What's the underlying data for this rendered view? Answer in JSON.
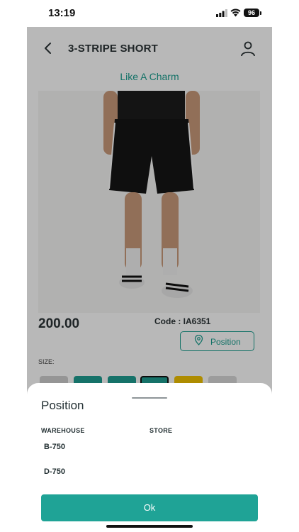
{
  "status_bar": {
    "time": "13:19",
    "battery": "96"
  },
  "header": {
    "title": "3-STRIPE SHORT"
  },
  "brand": "Like A Charm",
  "product": {
    "price": "200.00",
    "code": "Code : IA6351",
    "position_label": "Position",
    "size_label": "SIZE:",
    "swatch_colors": [
      "#cfcfcf",
      "#1f9e92",
      "#1f9e92",
      "#1f9e92",
      "#f2c200",
      "#d9d9d9"
    ]
  },
  "sheet": {
    "title": "Position",
    "columns": [
      "WAREHOUSE",
      "STORE"
    ],
    "rows": [
      {
        "warehouse": "B-750",
        "store": ""
      },
      {
        "warehouse": "D-750",
        "store": ""
      }
    ],
    "ok_label": "Ok"
  },
  "colors": {
    "accent": "#1fa396"
  }
}
